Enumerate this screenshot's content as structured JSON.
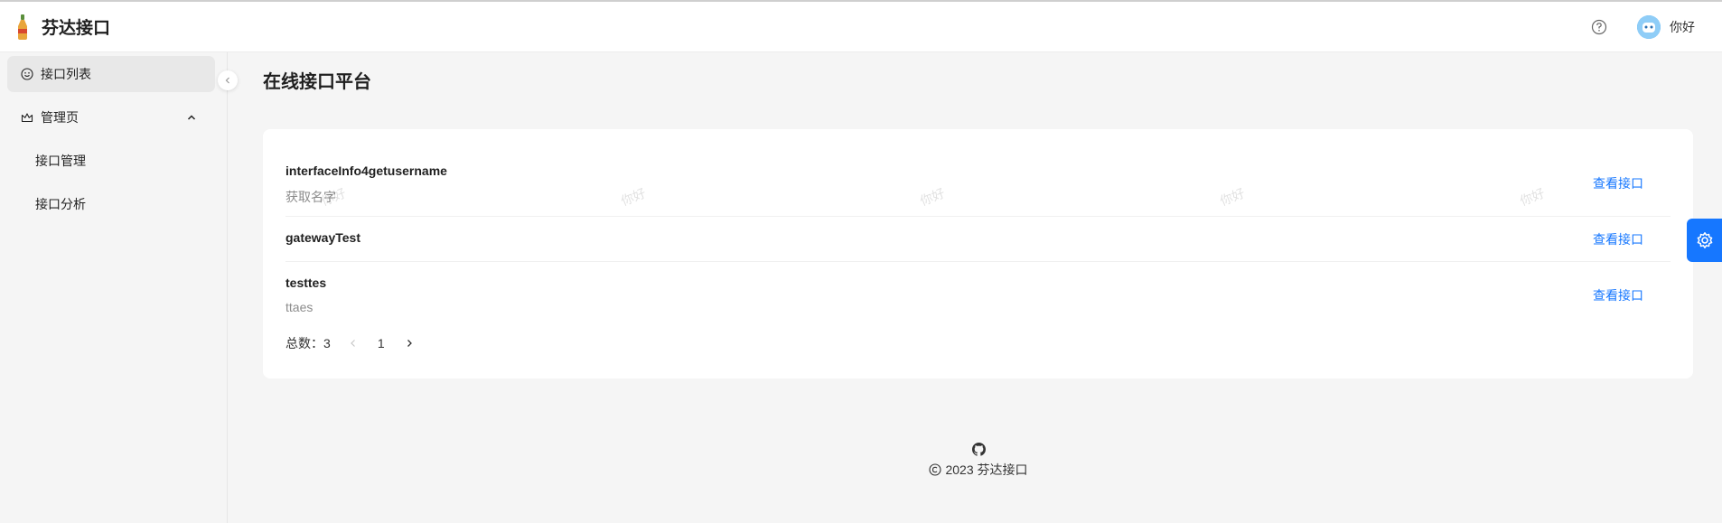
{
  "header": {
    "app_title": "芬达接口",
    "user_name": "你好",
    "icons": {
      "help": "question-circle-icon",
      "logo": "bottle-logo-icon",
      "avatar": "robot-avatar"
    }
  },
  "sidebar": {
    "items": [
      {
        "label": "接口列表",
        "icon": "smile-icon",
        "active": true
      },
      {
        "label": "管理页",
        "icon": "crown-icon",
        "expanded": true,
        "children": [
          {
            "label": "接口管理"
          },
          {
            "label": "接口分析"
          }
        ]
      }
    ]
  },
  "main": {
    "page_title": "在线接口平台",
    "list": [
      {
        "title": "interfaceInfo4getusername",
        "desc": "获取名字",
        "action": "查看接口"
      },
      {
        "title": "gatewayTest",
        "desc": "",
        "action": "查看接口"
      },
      {
        "title": "testtes",
        "desc": "ttaes",
        "action": "查看接口"
      }
    ],
    "pagination": {
      "total_label": "总数：3",
      "current_page": "1"
    },
    "watermark": "你好"
  },
  "footer": {
    "copyright": "2023 芬达接口"
  },
  "colors": {
    "accent": "#1677ff",
    "background": "#f5f5f5"
  }
}
